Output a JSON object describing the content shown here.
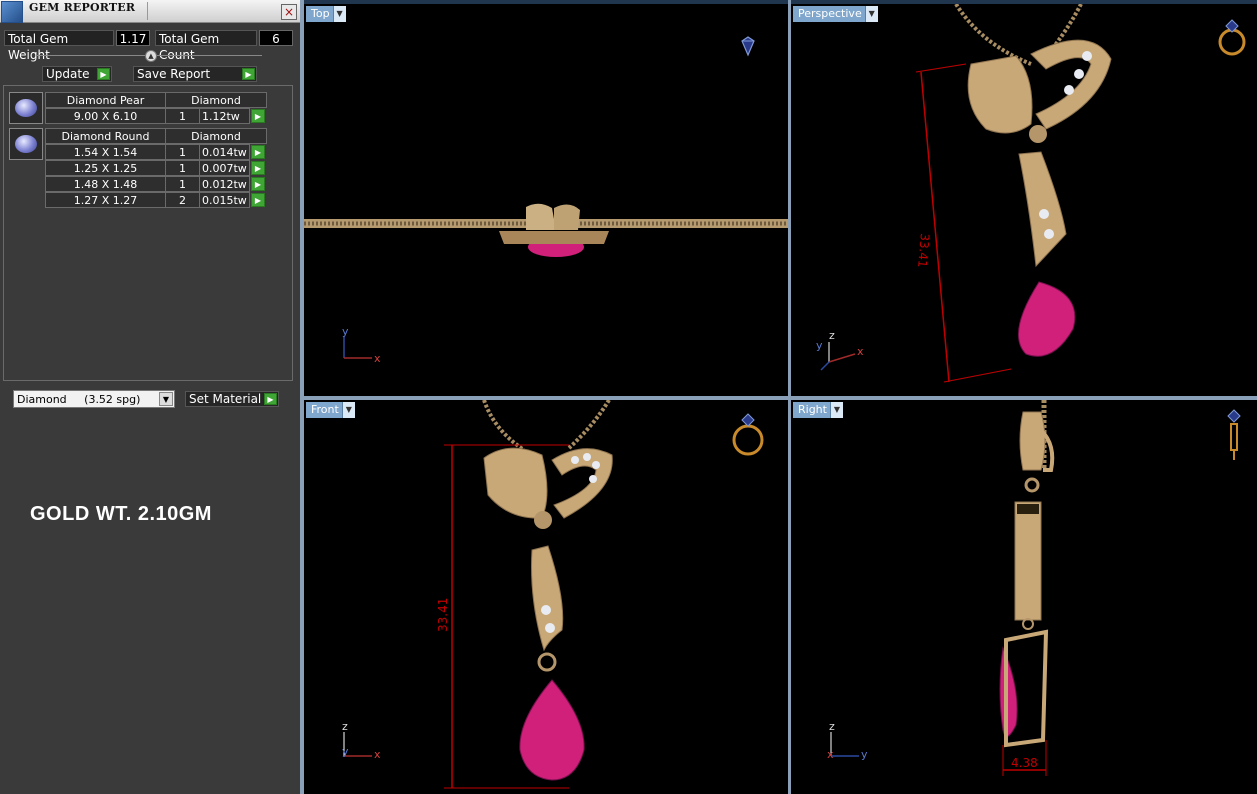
{
  "panel": {
    "title": "GEM REPORTER",
    "close_glyph": "×",
    "total_gem_weight_label": "Total Gem Weight",
    "total_gem_weight_value": "1.17",
    "total_gem_count_label": "Total Gem Count",
    "total_gem_count_value": "6",
    "collapse_glyph": "▲",
    "update_label": "Update",
    "save_report_label": "Save Report",
    "run_glyph": "▶"
  },
  "gem_groups": [
    {
      "name": "Diamond Pear",
      "type": "Diamond",
      "rows": [
        {
          "size": "9.00 X 6.10",
          "count": "1",
          "weight": "1.12tw"
        }
      ]
    },
    {
      "name": "Diamond Round",
      "type": "Diamond",
      "rows": [
        {
          "size": "1.54 X 1.54",
          "count": "1",
          "weight": "0.014tw"
        },
        {
          "size": "1.25 X 1.25",
          "count": "1",
          "weight": "0.007tw"
        },
        {
          "size": "1.48 X 1.48",
          "count": "1",
          "weight": "0.012tw"
        },
        {
          "size": "1.27 X 1.27",
          "count": "2",
          "weight": "0.015tw"
        }
      ]
    }
  ],
  "material": {
    "selected": "Diamond     (3.52 spg)",
    "dropdown_glyph": "▼",
    "set_material_label": "Set Material"
  },
  "gold_weight_text": "GOLD WT. 2.10GM",
  "viewports": {
    "top": {
      "label": "Top"
    },
    "perspective": {
      "label": "Perspective",
      "dimension": "33.41"
    },
    "front": {
      "label": "Front",
      "dimension": "33.41"
    },
    "right": {
      "label": "Right",
      "dimension": "4.38"
    },
    "dropdown_glyph": "▼"
  },
  "axes": {
    "x": "x",
    "y": "y",
    "z": "z"
  },
  "colors": {
    "gold": "#c9a878",
    "gem_pink": "#d0207a",
    "dimension_red": "#c00000",
    "viewport_tab": "#7fa6cc",
    "go_green": "#3fa535"
  },
  "icons": {
    "gem_view": "gem-icon",
    "ring_view": "ring-icon"
  }
}
